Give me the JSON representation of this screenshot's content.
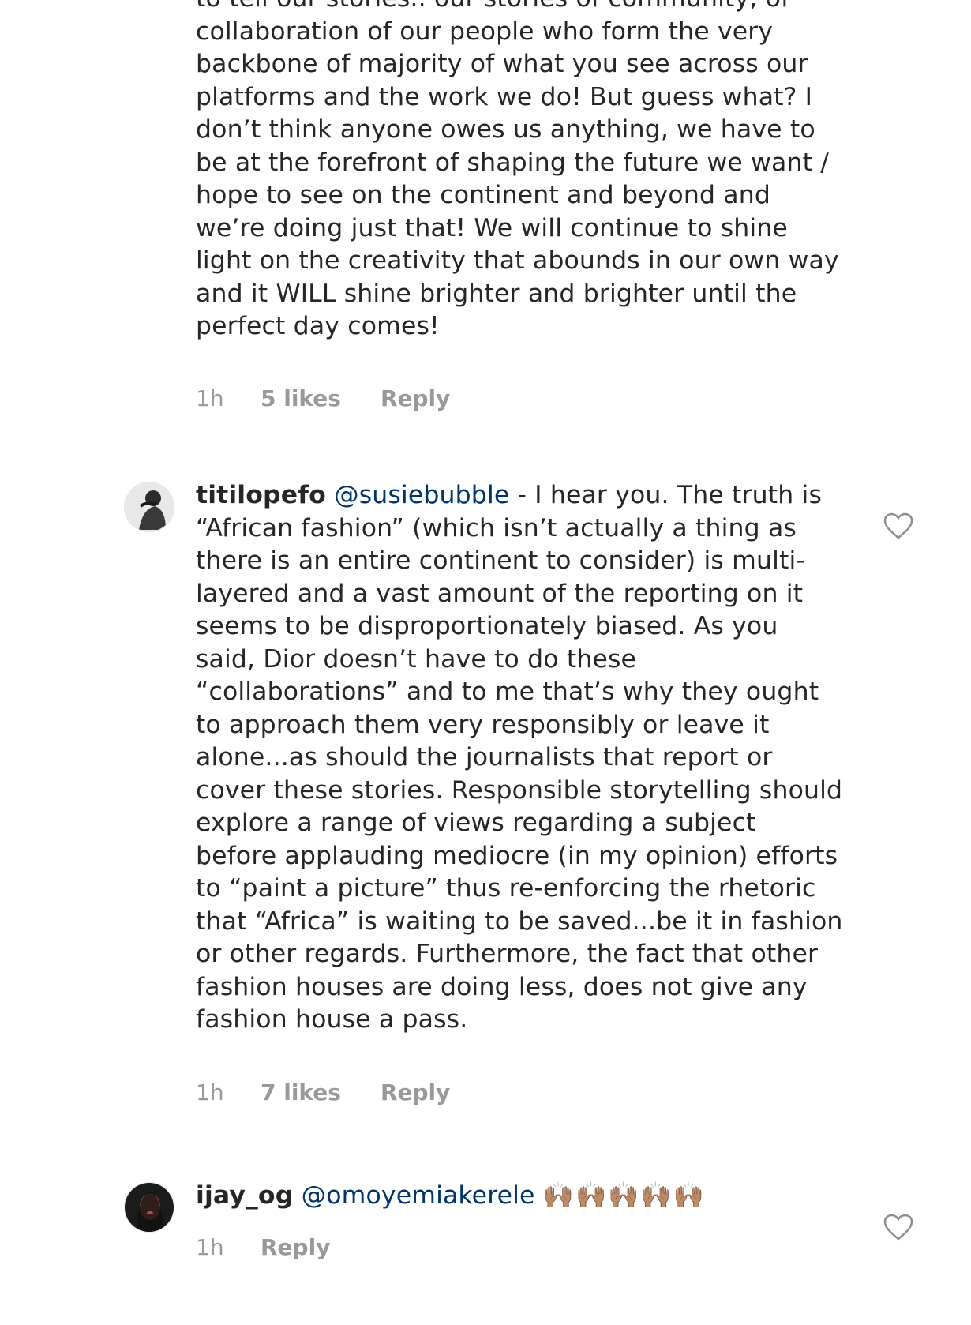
{
  "comments": [
    {
      "text_top": "to tell our stories.. our stories of community, of collaboration of our people who form the very backbone of majority of what you see across our platforms and the work we do! But guess what? I don’t think anyone owes us anything, we have to be at the forefront of shaping the future we want / hope to see on the continent and beyond and we’re doing just that! We will continue to shine light on the creativity that abounds in our own way and it WILL shine brighter and brighter until the perfect day comes!",
      "time": "1h",
      "likes": "5 likes",
      "reply": "Reply"
    },
    {
      "username": "titilopefo",
      "mention": "@susiebubble",
      "body": " - I hear you. The truth is “African fashion” (which isn’t actually a thing as there is an entire continent to consider) is multi-layered and a vast amount of the reporting on it seems to be disproportionately biased. As you said, Dior doesn’t have to do these “collaborations” and to me that’s why they ought to approach them very responsibly or leave it alone...as should the journalists that report or cover these stories. Responsible storytelling should explore a range of views regarding a subject before applauding mediocre (in my opinion) efforts to “paint a picture” thus re-enforcing the rhetoric that “Africa” is waiting to be saved...be it in fashion or other regards. Furthermore, the fact that other fashion houses are doing less, does not give any fashion house a pass.",
      "time": "1h",
      "likes": "7 likes",
      "reply": "Reply"
    },
    {
      "username": "ijay_og",
      "mention": "@omoyemiakerele",
      "emoji": "🙌🏽🙌🏽🙌🏽🙌🏽🙌🏽",
      "time": "1h",
      "reply": "Reply"
    }
  ],
  "colors": {
    "text": "#262626",
    "meta": "#999999",
    "mention": "#003569"
  },
  "icons": {
    "like": "heart-outline-icon"
  }
}
